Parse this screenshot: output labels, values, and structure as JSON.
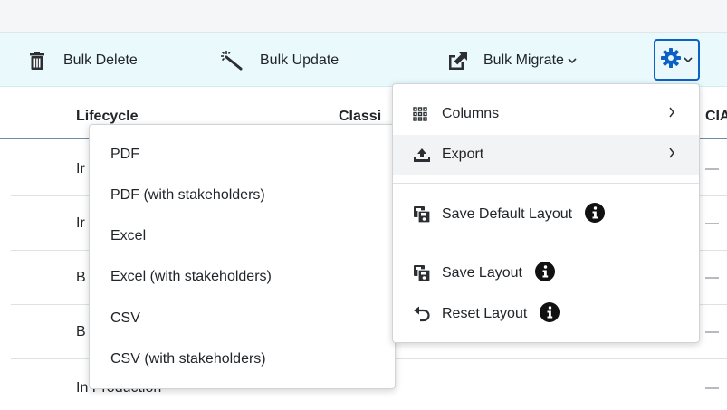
{
  "toolbar": {
    "bulk_delete": "Bulk Delete",
    "bulk_update": "Bulk Update",
    "bulk_migrate": "Bulk Migrate"
  },
  "table": {
    "headers": {
      "lifecycle": "Lifecycle",
      "classification": "Classi",
      "cia": "CIA"
    },
    "rows": [
      {
        "lifecycle": "Ir",
        "cia": "—"
      },
      {
        "lifecycle": "Ir",
        "cia": "—"
      },
      {
        "lifecycle": "B",
        "cia": "—"
      },
      {
        "lifecycle": "B",
        "cia": "—"
      },
      {
        "lifecycle": "In Production",
        "cia": "—"
      }
    ]
  },
  "export_menu": {
    "items": [
      "PDF",
      "PDF (with stakeholders)",
      "Excel",
      "Excel (with stakeholders)",
      "CSV",
      "CSV (with stakeholders)"
    ]
  },
  "settings_menu": {
    "columns": "Columns",
    "export": "Export",
    "save_default_layout": "Save Default Layout",
    "save_layout": "Save Layout",
    "reset_layout": "Reset Layout"
  },
  "colors": {
    "toolbar_bg": "#e9f9fc",
    "accent": "#0b62c4",
    "text": "#212529"
  }
}
